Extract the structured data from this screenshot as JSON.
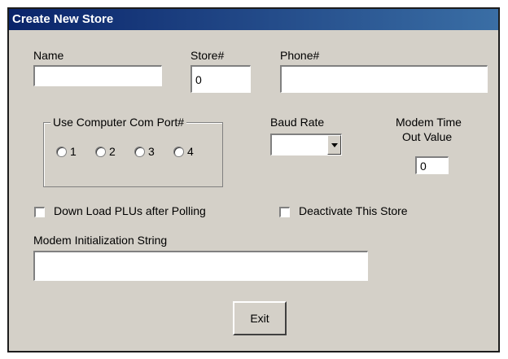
{
  "window": {
    "title": "Create New Store"
  },
  "fields": {
    "name": {
      "label": "Name",
      "value": ""
    },
    "store": {
      "label": "Store#",
      "value": "0"
    },
    "phone": {
      "label": "Phone#",
      "value": ""
    },
    "modem_init": {
      "label": "Modem Initialization String",
      "value": ""
    },
    "timeout": {
      "label_line1": "Modem Time",
      "label_line2": "Out Value",
      "value": "0"
    }
  },
  "com_port": {
    "label": "Use Computer Com Port#",
    "options": [
      "1",
      "2",
      "3",
      "4"
    ],
    "selected": null
  },
  "baud_rate": {
    "label": "Baud Rate",
    "value": ""
  },
  "checkboxes": {
    "download_plus": {
      "label": "Down Load PLUs after Polling",
      "checked": false
    },
    "deactivate": {
      "label": "Deactivate This Store",
      "checked": false
    }
  },
  "buttons": {
    "exit": "Exit"
  }
}
